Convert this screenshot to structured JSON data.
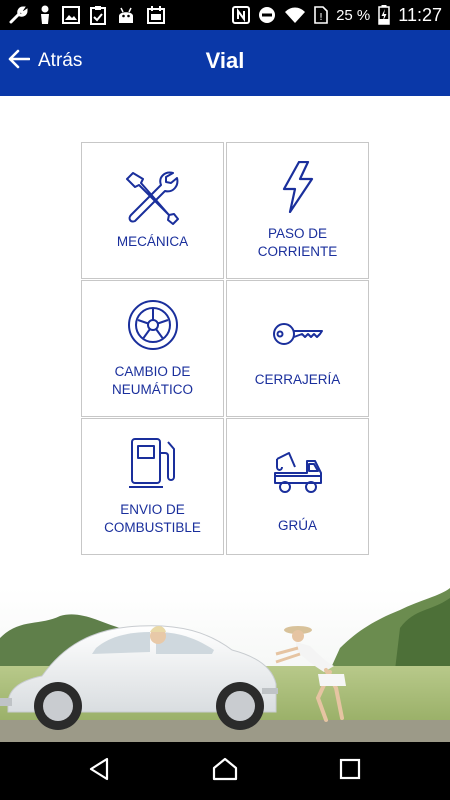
{
  "status_bar": {
    "battery_text": "25 %",
    "time": "11:27",
    "left_icons": [
      "wrench-icon",
      "person-icon",
      "image-icon",
      "clipboard-icon",
      "android-icon",
      "calendar-icon"
    ],
    "right_icons": [
      "nfc-icon",
      "do-not-disturb-icon",
      "wifi-icon",
      "no-sim-icon",
      "battery-charging-icon"
    ]
  },
  "header": {
    "back_label": "Atrás",
    "title": "Vial",
    "background_color": "#0a38a8"
  },
  "services": [
    {
      "label": "MECÁNICA",
      "icon": "tools-icon"
    },
    {
      "label": "PASO DE\nCORRIENTE",
      "icon": "lightning-icon"
    },
    {
      "label": "CAMBIO DE\nNEUMÁTICO",
      "icon": "tire-icon"
    },
    {
      "label": "CERRAJERÍA",
      "icon": "key-icon"
    },
    {
      "label": "ENVIO DE\nCOMBUSTIBLE",
      "icon": "fuel-pump-icon"
    },
    {
      "label": "GRÚA",
      "icon": "tow-truck-icon"
    }
  ],
  "colors": {
    "accent": "#1a2f9c",
    "tile_border": "#c7c7c7"
  },
  "nav_bar": {
    "icons": [
      "back-icon",
      "home-icon",
      "recents-icon"
    ]
  }
}
